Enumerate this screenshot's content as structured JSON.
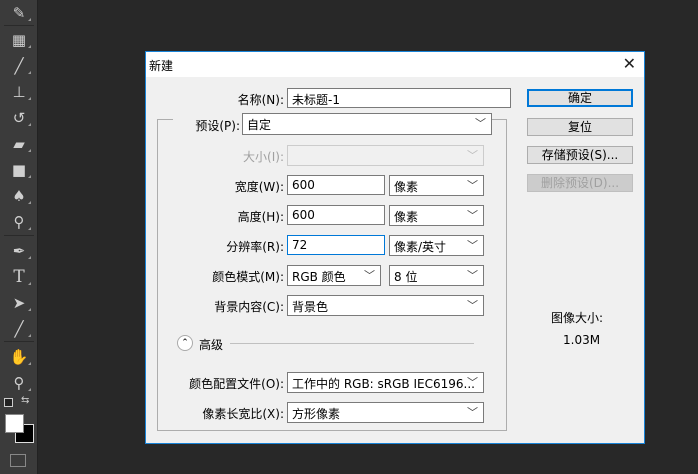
{
  "toolbar": {
    "tools": [
      "eyedropper-icon",
      "marquee-icon",
      "brush-icon",
      "stamp-icon",
      "history-brush-icon",
      "eraser-icon",
      "gradient-icon",
      "blur-icon",
      "dodge-icon",
      "pen-icon",
      "type-icon",
      "path-select-icon",
      "line-icon",
      "hand-icon",
      "zoom-icon"
    ]
  },
  "dialog": {
    "title": "新建",
    "name_label": "名称(N):",
    "name_value": "未标题-1",
    "preset_label": "预设(P):",
    "preset_value": "自定",
    "size_label": "大小(I):",
    "size_value": "",
    "width_label": "宽度(W):",
    "width_value": "600",
    "width_unit": "像素",
    "height_label": "高度(H):",
    "height_value": "600",
    "height_unit": "像素",
    "resolution_label": "分辨率(R):",
    "resolution_value": "72",
    "resolution_unit": "像素/英寸",
    "color_mode_label": "颜色模式(M):",
    "color_mode_value": "RGB 颜色",
    "bit_depth_value": "8 位",
    "background_label": "背景内容(C):",
    "background_value": "背景色",
    "advanced_label": "高级",
    "color_profile_label": "颜色配置文件(O):",
    "color_profile_value": "工作中的 RGB: sRGB IEC6196...",
    "pixel_aspect_label": "像素长宽比(X):",
    "pixel_aspect_value": "方形像素",
    "ok_label": "确定",
    "reset_label": "复位",
    "save_preset_label": "存储预设(S)...",
    "delete_preset_label": "删除预设(D)...",
    "image_size_label": "图像大小:",
    "image_size_value": "1.03M"
  }
}
